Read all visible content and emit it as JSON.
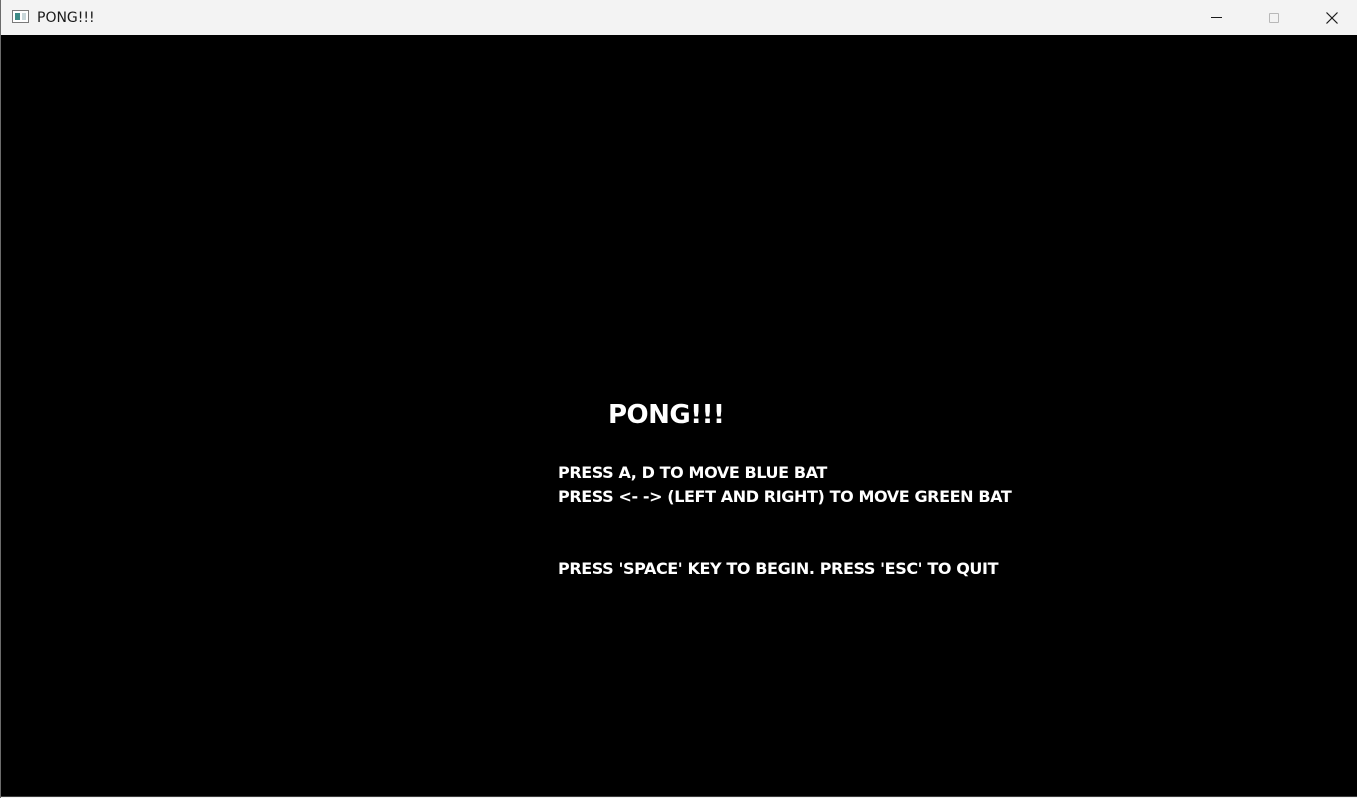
{
  "window": {
    "title": "PONG!!!",
    "icon": "app-window-icon",
    "controls": {
      "minimize_icon": "minimize-icon",
      "maximize_icon": "maximize-icon",
      "close_icon": "close-icon"
    }
  },
  "game": {
    "title": "PONG!!!",
    "instructions": [
      "PRESS A, D TO MOVE BLUE BAT",
      "PRESS <- -> (LEFT AND RIGHT) TO MOVE GREEN BAT",
      "PRESS 'SPACE' KEY TO BEGIN. PRESS 'ESC' TO QUIT"
    ],
    "colors": {
      "background": "#000000",
      "text": "#ffffff"
    }
  }
}
